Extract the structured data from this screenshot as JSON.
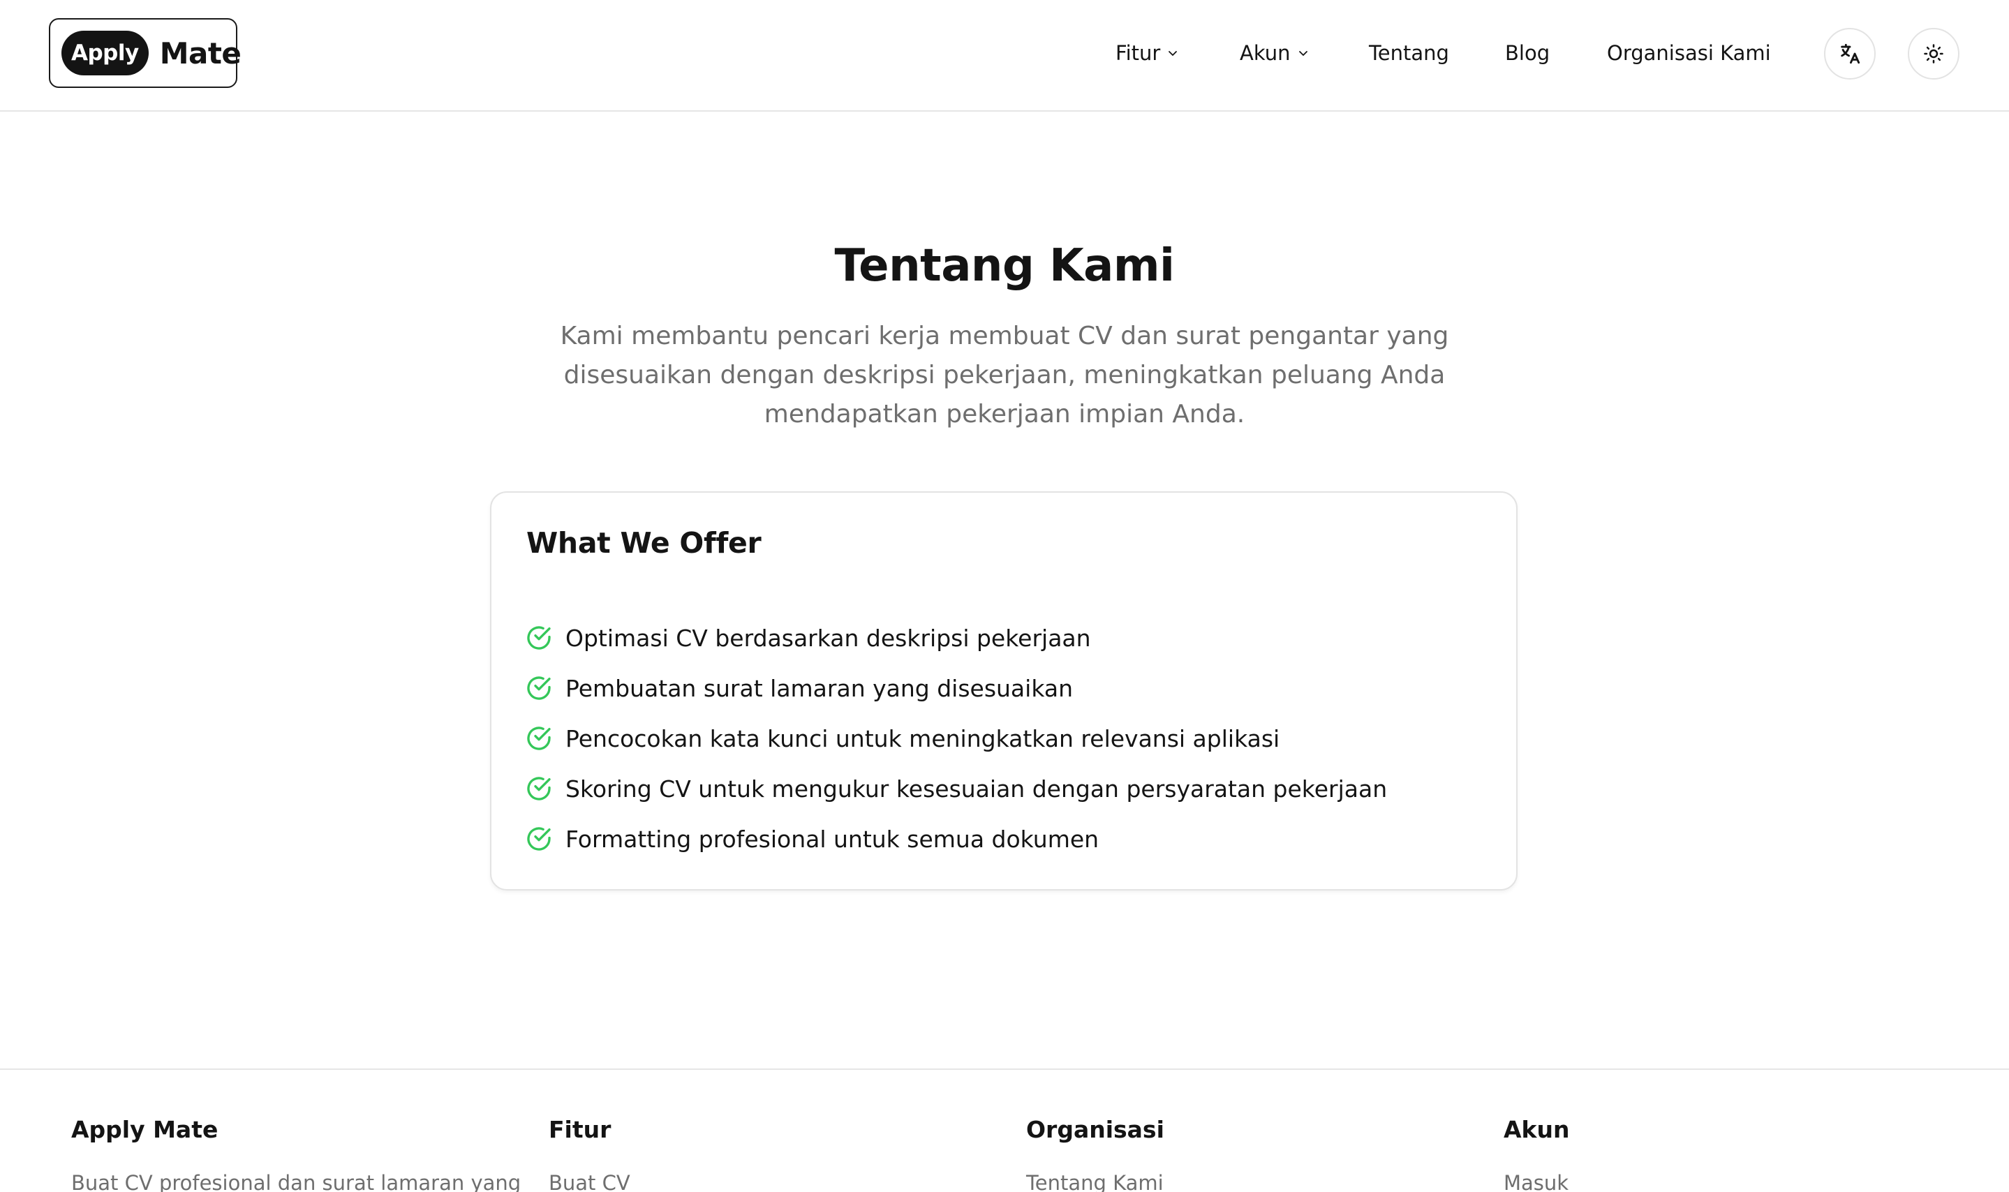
{
  "header": {
    "logo": {
      "pill": "Apply",
      "word": "Mate"
    },
    "nav": {
      "fitur": "Fitur",
      "akun": "Akun",
      "tentang": "Tentang",
      "blog": "Blog",
      "organisasi": "Organisasi Kami"
    },
    "icons": {
      "language": "translate-icon",
      "theme": "sun-icon",
      "dropdown": "chevron-down-icon"
    }
  },
  "main": {
    "title": "Tentang Kami",
    "description": "Kami membantu pencari kerja membuat CV dan surat pengantar yang disesuaikan dengan deskripsi pekerjaan, meningkatkan peluang Anda mendapatkan pekerjaan impian Anda.",
    "offer": {
      "title": "What We Offer",
      "items": [
        "Optimasi CV berdasarkan deskripsi pekerjaan",
        "Pembuatan surat lamaran yang disesuaikan",
        "Pencocokan kata kunci untuk meningkatkan relevansi aplikasi",
        "Skoring CV untuk mengukur kesesuaian dengan persyaratan pekerjaan",
        "Formatting profesional untuk semua dokumen"
      ],
      "check_color": "#34c759",
      "check_icon": "check-circle-icon"
    }
  },
  "footer": {
    "columns": [
      {
        "heading": "Apply Mate",
        "first": "Buat CV profesional dan surat lamaran yang"
      },
      {
        "heading": "Fitur",
        "first": "Buat CV"
      },
      {
        "heading": "Organisasi",
        "first": "Tentang Kami"
      },
      {
        "heading": "Akun",
        "first": "Masuk"
      }
    ]
  }
}
